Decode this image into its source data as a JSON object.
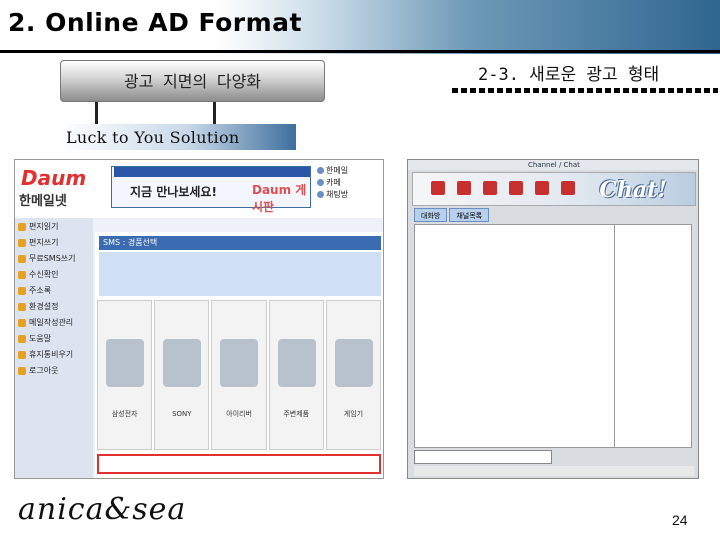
{
  "header": {
    "title": "2. Online AD Format"
  },
  "left_panel": {
    "capsule_label": "광고 지면의 다양화",
    "slogan": "Luck to You Solution"
  },
  "right_panel": {
    "title": "2-3. 새로운 광고 형태"
  },
  "left_screenshot": {
    "logo": "Daum",
    "service": "한메일넷",
    "banner_main": "지금 만나보세요!",
    "banner_brand": "Daum 게시판",
    "sms_header": "SMS : 경품선택",
    "right_links": [
      "한메일",
      "카페",
      "채팅방"
    ],
    "menu": [
      "편지읽기",
      "편지쓰기",
      "무료SMS쓰기",
      "수신확인",
      "주소록",
      "환경설정",
      "메일작성관리",
      "도움말",
      "휴지통비우기",
      "로그아웃"
    ],
    "products": [
      "삼성전자",
      "SONY",
      "아이리버",
      "주변제품",
      "게임기"
    ]
  },
  "right_screenshot": {
    "window_title": "Channel / Chat",
    "logo": "Chat!",
    "tabs": [
      "대화방",
      "채널목록"
    ]
  },
  "footer": {
    "logo_text": "anica&sea",
    "page_number": "24"
  }
}
